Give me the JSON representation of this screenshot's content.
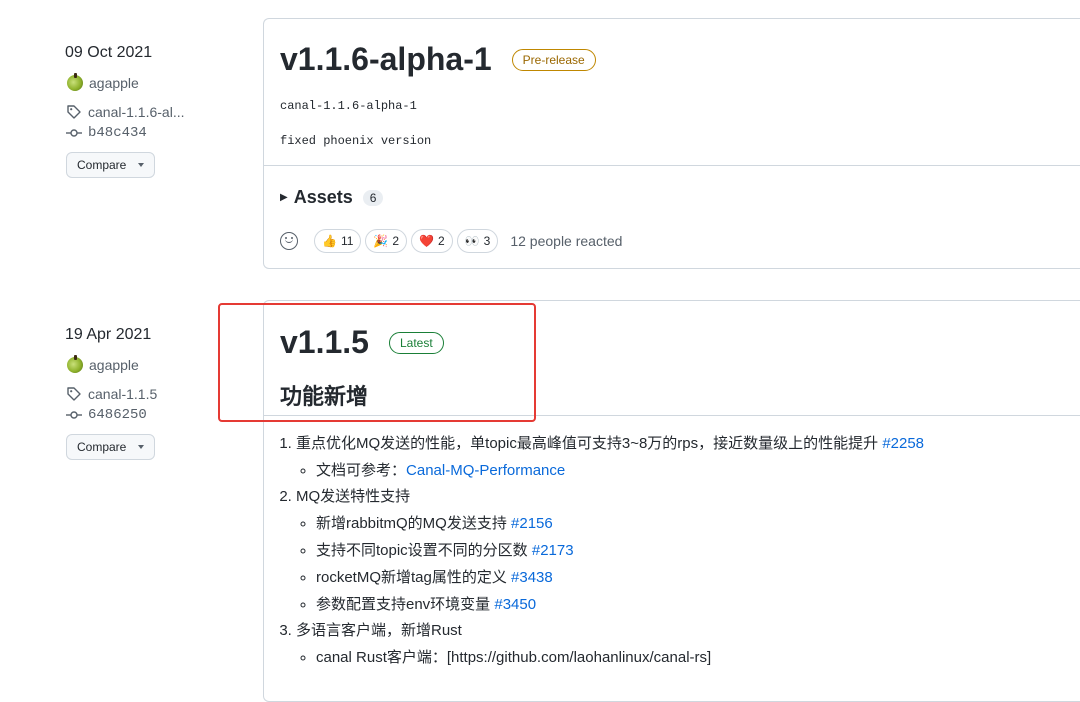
{
  "release1": {
    "date": "09 Oct 2021",
    "author": "agapple",
    "tag": "canal-1.1.6-al...",
    "commit": "b48c434",
    "compare_label": "Compare",
    "title": "v1.1.6-alpha-1",
    "badge": "Pre-release",
    "line1": "canal-1.1.6-alpha-1",
    "line2": "fixed phoenix version",
    "assets_label": "Assets",
    "assets_count": "6",
    "reactions": [
      {
        "icon": "thumbs-up-icon",
        "glyph": "👍",
        "count": "11"
      },
      {
        "icon": "party-icon",
        "glyph": "🎉",
        "count": "2"
      },
      {
        "icon": "heart-icon",
        "glyph": "❤️",
        "count": "2"
      },
      {
        "icon": "eyes-icon",
        "glyph": "👀",
        "count": "3"
      }
    ],
    "reacted_text": "12 people reacted"
  },
  "release2": {
    "date": "19 Apr 2021",
    "author": "agapple",
    "tag": "canal-1.1.5",
    "commit": "6486250",
    "compare_label": "Compare",
    "title": "v1.1.5",
    "badge": "Latest",
    "section_heading": "功能新增",
    "items": [
      {
        "text": "重点优化MQ发送的性能，单topic最高峰值可支持3~8万的rps，接近数量级上的性能提升 ",
        "link": "#2258",
        "sub": [
          {
            "text": "文档可参考：",
            "link": "Canal-MQ-Performance"
          }
        ]
      },
      {
        "text": "MQ发送特性支持",
        "link": "",
        "sub": [
          {
            "text": "新增rabbitmQ的MQ发送支持 ",
            "link": "#2156"
          },
          {
            "text": "支持不同topic设置不同的分区数 ",
            "link": "#2173"
          },
          {
            "text": "rocketMQ新增tag属性的定义 ",
            "link": "#3438"
          },
          {
            "text": "参数配置支持env环境变量 ",
            "link": "#3450"
          }
        ]
      },
      {
        "text": "多语言客户端，新增Rust",
        "link": "",
        "sub": [
          {
            "text": "canal Rust客户端：[https://github.com/laohanlinux/canal-rs]",
            "link": ""
          }
        ]
      }
    ]
  },
  "colors": {
    "link": "#0969da",
    "prerelease": "#9a6700",
    "latest": "#1a7f37",
    "highlight": "#e53a34"
  }
}
